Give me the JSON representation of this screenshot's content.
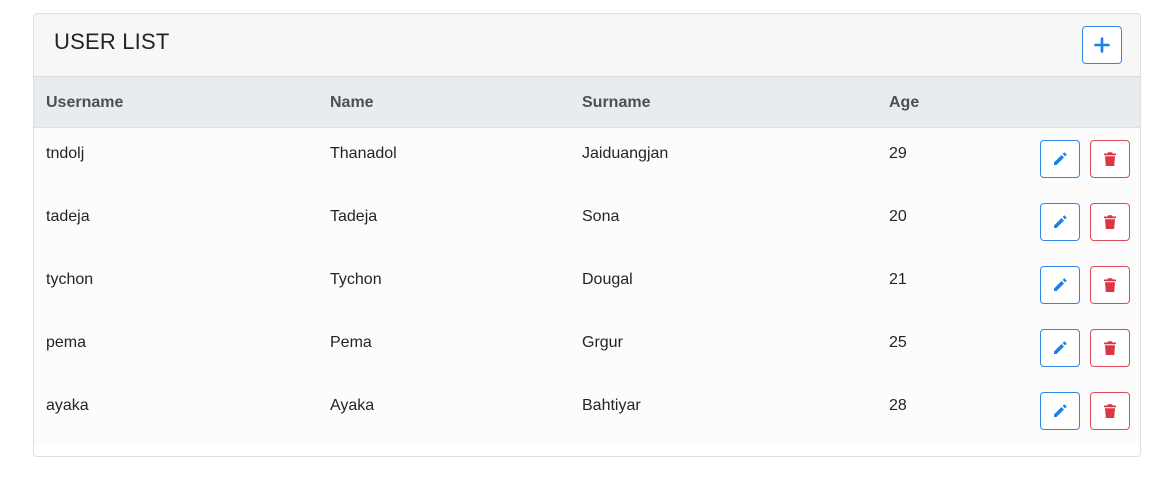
{
  "header": {
    "title": "USER LIST",
    "add_icon": "plus-icon"
  },
  "table": {
    "columns": [
      "Username",
      "Name",
      "Surname",
      "Age"
    ],
    "rows": [
      {
        "username": "tndolj",
        "name": "Thanadol",
        "surname": "Jaiduangjan",
        "age": "29"
      },
      {
        "username": "tadeja",
        "name": "Tadeja",
        "surname": "Sona",
        "age": "20"
      },
      {
        "username": "tychon",
        "name": "Tychon",
        "surname": "Dougal",
        "age": "21"
      },
      {
        "username": "pema",
        "name": "Pema",
        "surname": "Grgur",
        "age": "25"
      },
      {
        "username": "ayaka",
        "name": "Ayaka",
        "surname": "Bahtiyar",
        "age": "28"
      }
    ],
    "row_actions": {
      "edit_icon": "pencil-icon",
      "delete_icon": "trash-icon"
    }
  },
  "colors": {
    "primary": "#1d7fe8",
    "danger": "#dc3545",
    "header_bg": "#f7f7f7",
    "thead_bg": "#e9ecef"
  }
}
